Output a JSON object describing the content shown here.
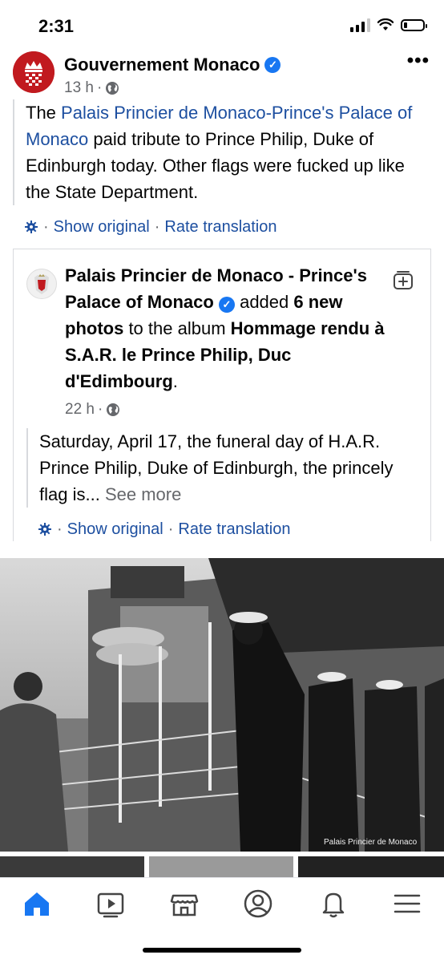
{
  "status": {
    "time": "2:31",
    "battery_level": 0.2
  },
  "post": {
    "page_name": "Gouvernement Monaco",
    "time": "13 h",
    "separator": "·",
    "text_prefix": "The ",
    "text_link": "Palais Princier de Monaco-Prince's Palace of Monaco",
    "text_suffix": " paid tribute to Prince Philip, Duke of Edinburgh today. Other flags were fucked up like the State Department.",
    "show_original": "Show original",
    "rate_translation": "Rate translation"
  },
  "shared": {
    "page_name": "Palais Princier de Monaco - Prince's Palace of Monaco",
    "added_text": " added ",
    "photos_count": "6 new photos",
    "to_album": " to the album ",
    "album_name": "Hommage rendu à S.A.R. le Prince Philip, Duc d'Edimbourg",
    "period": ".",
    "time": "22 h",
    "separator": "·",
    "body": "Saturday, April 17, the funeral day of H.A.R. Prince Philip, Duke of Edinburgh, the princely flag is...",
    "see_more": "See more",
    "show_original": "Show original",
    "rate_translation": "Rate translation"
  },
  "photo": {
    "watermark": "Palais Princier de Monaco"
  },
  "tabs": [
    {
      "icon": "home-icon",
      "active": true
    },
    {
      "icon": "video-icon",
      "active": false
    },
    {
      "icon": "marketplace-icon",
      "active": false
    },
    {
      "icon": "profile-icon",
      "active": false
    },
    {
      "icon": "bell-icon",
      "active": false
    },
    {
      "icon": "menu-icon",
      "active": false
    }
  ],
  "colors": {
    "accent": "#1877f2",
    "link": "#1d4fa0",
    "meta": "#65676b"
  }
}
